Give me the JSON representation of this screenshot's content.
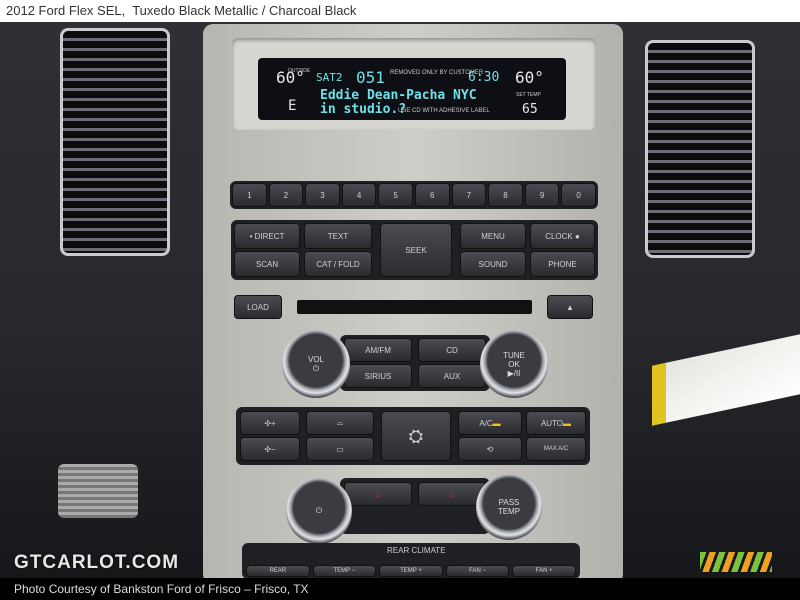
{
  "title_bar": {
    "text": "2012 Ford Flex SEL,  Tuxedo Black Metallic / Charcoal Black"
  },
  "display": {
    "outside_temp_left": "60°",
    "outside_label": "OUTSIDE",
    "band": "SAT2",
    "channel": "051",
    "notice_top": "REMOVED ONLY BY CUSTOMER",
    "clock": "6:30",
    "set_temp_top": "60°",
    "set_temp_label": "SET TEMP",
    "compass": "E",
    "artist": "Eddie Dean-Pacha NYC",
    "song": "in studio.?",
    "notice_bottom": "USE CD WITH ADHESIVE LABEL",
    "set_temp_bottom": "65"
  },
  "presets": [
    "1",
    "2",
    "3",
    "4",
    "5",
    "6",
    "7",
    "8",
    "9",
    "0"
  ],
  "audio_buttons": {
    "direct": "• DIRECT",
    "text": "TEXT",
    "scan": "SCAN",
    "cat_fold": "CAT / FOLD",
    "seek": "SEEK",
    "menu": "MENU",
    "clock": "CLOCK ●",
    "sound": "SOUND",
    "phone": "PHONE",
    "load": "LOAD",
    "eject": "▲"
  },
  "sources": {
    "am_fm": "AM/FM",
    "cd": "CD",
    "sirius": "SIRIUS",
    "aux": "AUX"
  },
  "knobs": {
    "vol": "VOL",
    "tune": "TUNE",
    "ok": "OK",
    "play_pause": "▶/II",
    "pass_temp": "PASS TEMP"
  },
  "climate": {
    "ac": "A/C",
    "auto": "AUTO",
    "max_ac": "MAX A/C",
    "fan_up": "+",
    "fan_down": "−"
  },
  "rear_climate": {
    "label": "REAR CLIMATE",
    "buttons": [
      "REAR",
      "TEMP −",
      "TEMP +",
      "FAN −",
      "FAN +"
    ]
  },
  "indicator_color": "#f2c21a",
  "display_color": "#6fe0e6",
  "watermark": "GTCARLOT.COM",
  "footer": {
    "text": "Photo Courtesy of Bankston Ford of Frisco – Frisco, TX"
  }
}
